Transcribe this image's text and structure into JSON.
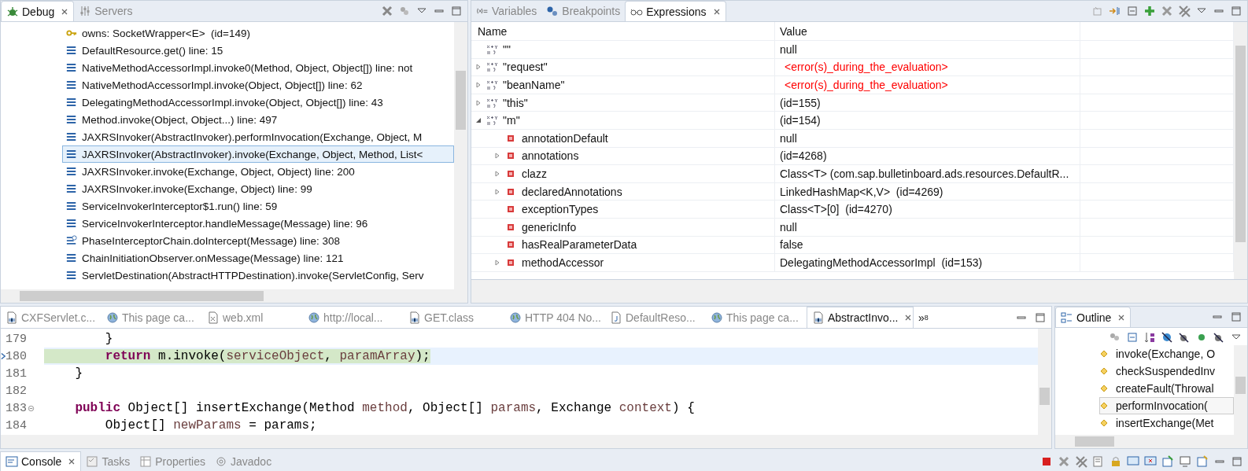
{
  "debug_view": {
    "tabs": [
      {
        "label": "Debug",
        "kind": "debug",
        "selected": true
      },
      {
        "label": "Servers",
        "kind": "servers",
        "selected": false
      }
    ],
    "frames": [
      {
        "kind": "monitor",
        "label": "owns: SocketWrapper<E>  (id=149)",
        "selected": false
      },
      {
        "kind": "frame",
        "label": "DefaultResource.get() line: 15",
        "selected": false
      },
      {
        "kind": "frame",
        "label": "NativeMethodAccessorImpl.invoke0(Method, Object, Object[]) line: not",
        "selected": false
      },
      {
        "kind": "frame",
        "label": "NativeMethodAccessorImpl.invoke(Object, Object[]) line: 62",
        "selected": false
      },
      {
        "kind": "frame",
        "label": "DelegatingMethodAccessorImpl.invoke(Object, Object[]) line: 43",
        "selected": false
      },
      {
        "kind": "frame",
        "label": "Method.invoke(Object, Object...) line: 497",
        "selected": false
      },
      {
        "kind": "frame",
        "label": "JAXRSInvoker(AbstractInvoker).performInvocation(Exchange, Object, M",
        "selected": false
      },
      {
        "kind": "frame",
        "label": "JAXRSInvoker(AbstractInvoker).invoke(Exchange, Object, Method, List<",
        "selected": true
      },
      {
        "kind": "frame",
        "label": "JAXRSInvoker.invoke(Exchange, Object, Object) line: 200",
        "selected": false
      },
      {
        "kind": "frame",
        "label": "JAXRSInvoker.invoke(Exchange, Object) line: 99",
        "selected": false
      },
      {
        "kind": "frame",
        "label": "ServiceInvokerInterceptor$1.run() line: 59",
        "selected": false
      },
      {
        "kind": "frame",
        "label": "ServiceInvokerInterceptor.handleMessage(Message) line: 96",
        "selected": false
      },
      {
        "kind": "frame_waiting",
        "label": "PhaseInterceptorChain.doIntercept(Message) line: 308",
        "selected": false
      },
      {
        "kind": "frame",
        "label": "ChainInitiationObserver.onMessage(Message) line: 121",
        "selected": false
      },
      {
        "kind": "frame",
        "label": "ServletDestination(AbstractHTTPDestination).invoke(ServletConfig, Serv",
        "selected": false
      }
    ]
  },
  "expressions_view": {
    "tabs": [
      {
        "label": "Variables",
        "kind": "variables",
        "selected": false
      },
      {
        "label": "Breakpoints",
        "kind": "breakpoints",
        "selected": false
      },
      {
        "label": "Expressions",
        "kind": "expressions",
        "selected": true
      }
    ],
    "columns": [
      "Name",
      "Value"
    ],
    "rows": [
      {
        "kind": "expression",
        "name": "\"\"",
        "value": "null",
        "error": false
      },
      {
        "kind": "expression",
        "name": "\"request\"",
        "value": "<error(s)_during_the_evaluation>",
        "error": true,
        "expanded": false
      },
      {
        "kind": "expression",
        "name": "\"beanName\"",
        "value": "<error(s)_during_the_evaluation>",
        "error": true,
        "expanded": false
      },
      {
        "kind": "expression",
        "name": "\"this\"",
        "value": "(id=155)",
        "error": false,
        "expanded": false
      },
      {
        "kind": "expression",
        "name": "\"m\"",
        "value": "(id=154)",
        "error": false,
        "expanded": true,
        "children": [
          {
            "kind": "field",
            "name": "annotationDefault",
            "value": "null",
            "error": false
          },
          {
            "kind": "field",
            "name": "annotations",
            "value": "(id=4268)",
            "error": false,
            "expanded": false
          },
          {
            "kind": "field",
            "name": "clazz",
            "value": "Class<T> (com.sap.bulletinboard.ads.resources.DefaultR...",
            "error": false,
            "expanded": false
          },
          {
            "kind": "field",
            "name": "declaredAnnotations",
            "value": "LinkedHashMap<K,V>  (id=4269)",
            "error": false,
            "expanded": false
          },
          {
            "kind": "field",
            "name": "exceptionTypes",
            "value": "Class<T>[0]  (id=4270)",
            "error": false
          },
          {
            "kind": "field",
            "name": "genericInfo",
            "value": "null",
            "error": false
          },
          {
            "kind": "field",
            "name": "hasRealParameterData",
            "value": "false",
            "error": false
          },
          {
            "kind": "field",
            "name": "methodAccessor",
            "value": "DelegatingMethodAccessorImpl  (id=153)",
            "error": false,
            "expanded": false
          }
        ]
      }
    ]
  },
  "editor": {
    "tabs": [
      {
        "label": "CXFServlet.c...",
        "kind": "class",
        "selected": false
      },
      {
        "label": "This page ca...",
        "kind": "web",
        "selected": false
      },
      {
        "label": "web.xml",
        "kind": "xml",
        "selected": false
      },
      {
        "label": "http://local...",
        "kind": "web",
        "selected": false
      },
      {
        "label": "GET.class",
        "kind": "class",
        "selected": false
      },
      {
        "label": "HTTP 404 No...",
        "kind": "web",
        "selected": false
      },
      {
        "label": "DefaultReso...",
        "kind": "java",
        "selected": false
      },
      {
        "label": "This page ca...",
        "kind": "web",
        "selected": false
      },
      {
        "label": "AbstractInvo...",
        "kind": "class",
        "selected": true
      }
    ],
    "overflow": {
      "label": "»",
      "count": "8"
    },
    "lines": [
      {
        "number": "179",
        "current": false,
        "folding": false,
        "tokens": [
          {
            "kind": "plain",
            "text": "        }"
          }
        ]
      },
      {
        "number": "180",
        "current": true,
        "folding": false,
        "tokens": [
          {
            "kind": "keyword",
            "text": "        return"
          },
          {
            "kind": "plain",
            "text": " m.invoke("
          },
          {
            "kind": "variable",
            "text": "serviceObject"
          },
          {
            "kind": "plain",
            "text": ", "
          },
          {
            "kind": "variable",
            "text": "paramArray"
          },
          {
            "kind": "plain",
            "text": ");"
          }
        ]
      },
      {
        "number": "181",
        "current": false,
        "folding": false,
        "tokens": [
          {
            "kind": "plain",
            "text": "    }"
          }
        ]
      },
      {
        "number": "182",
        "current": false,
        "folding": false
      },
      {
        "number": "183",
        "current": false,
        "folding": true,
        "tokens": [
          {
            "kind": "keyword",
            "text": "    public"
          },
          {
            "kind": "plain",
            "text": " Object[] insertExchange(Method "
          },
          {
            "kind": "variable",
            "text": "method"
          },
          {
            "kind": "plain",
            "text": ", Object[] "
          },
          {
            "kind": "variable",
            "text": "params"
          },
          {
            "kind": "plain",
            "text": ", Exchange "
          },
          {
            "kind": "variable",
            "text": "context"
          },
          {
            "kind": "plain",
            "text": ") {"
          }
        ]
      },
      {
        "number": "184",
        "current": false,
        "folding": false,
        "tokens": [
          {
            "kind": "plain",
            "text": "        Object[] "
          },
          {
            "kind": "variable",
            "text": "newParams"
          },
          {
            "kind": "plain",
            "text": " = params;"
          }
        ]
      }
    ]
  },
  "outline": {
    "title": "Outline",
    "items": [
      {
        "label": "invoke(Exchange, O",
        "selected": false
      },
      {
        "label": "checkSuspendedInv",
        "selected": false
      },
      {
        "label": "createFault(Throwal",
        "selected": false
      },
      {
        "label": "performInvocation(",
        "selected": true
      },
      {
        "label": "insertExchange(Met",
        "selected": false
      }
    ]
  },
  "bottom_tabs": [
    {
      "label": "Console",
      "kind": "console",
      "selected": true
    },
    {
      "label": "Tasks",
      "kind": "tasks",
      "selected": false
    },
    {
      "label": "Properties",
      "kind": "properties",
      "selected": false
    },
    {
      "label": "Javadoc",
      "kind": "javadoc",
      "selected": false
    }
  ]
}
